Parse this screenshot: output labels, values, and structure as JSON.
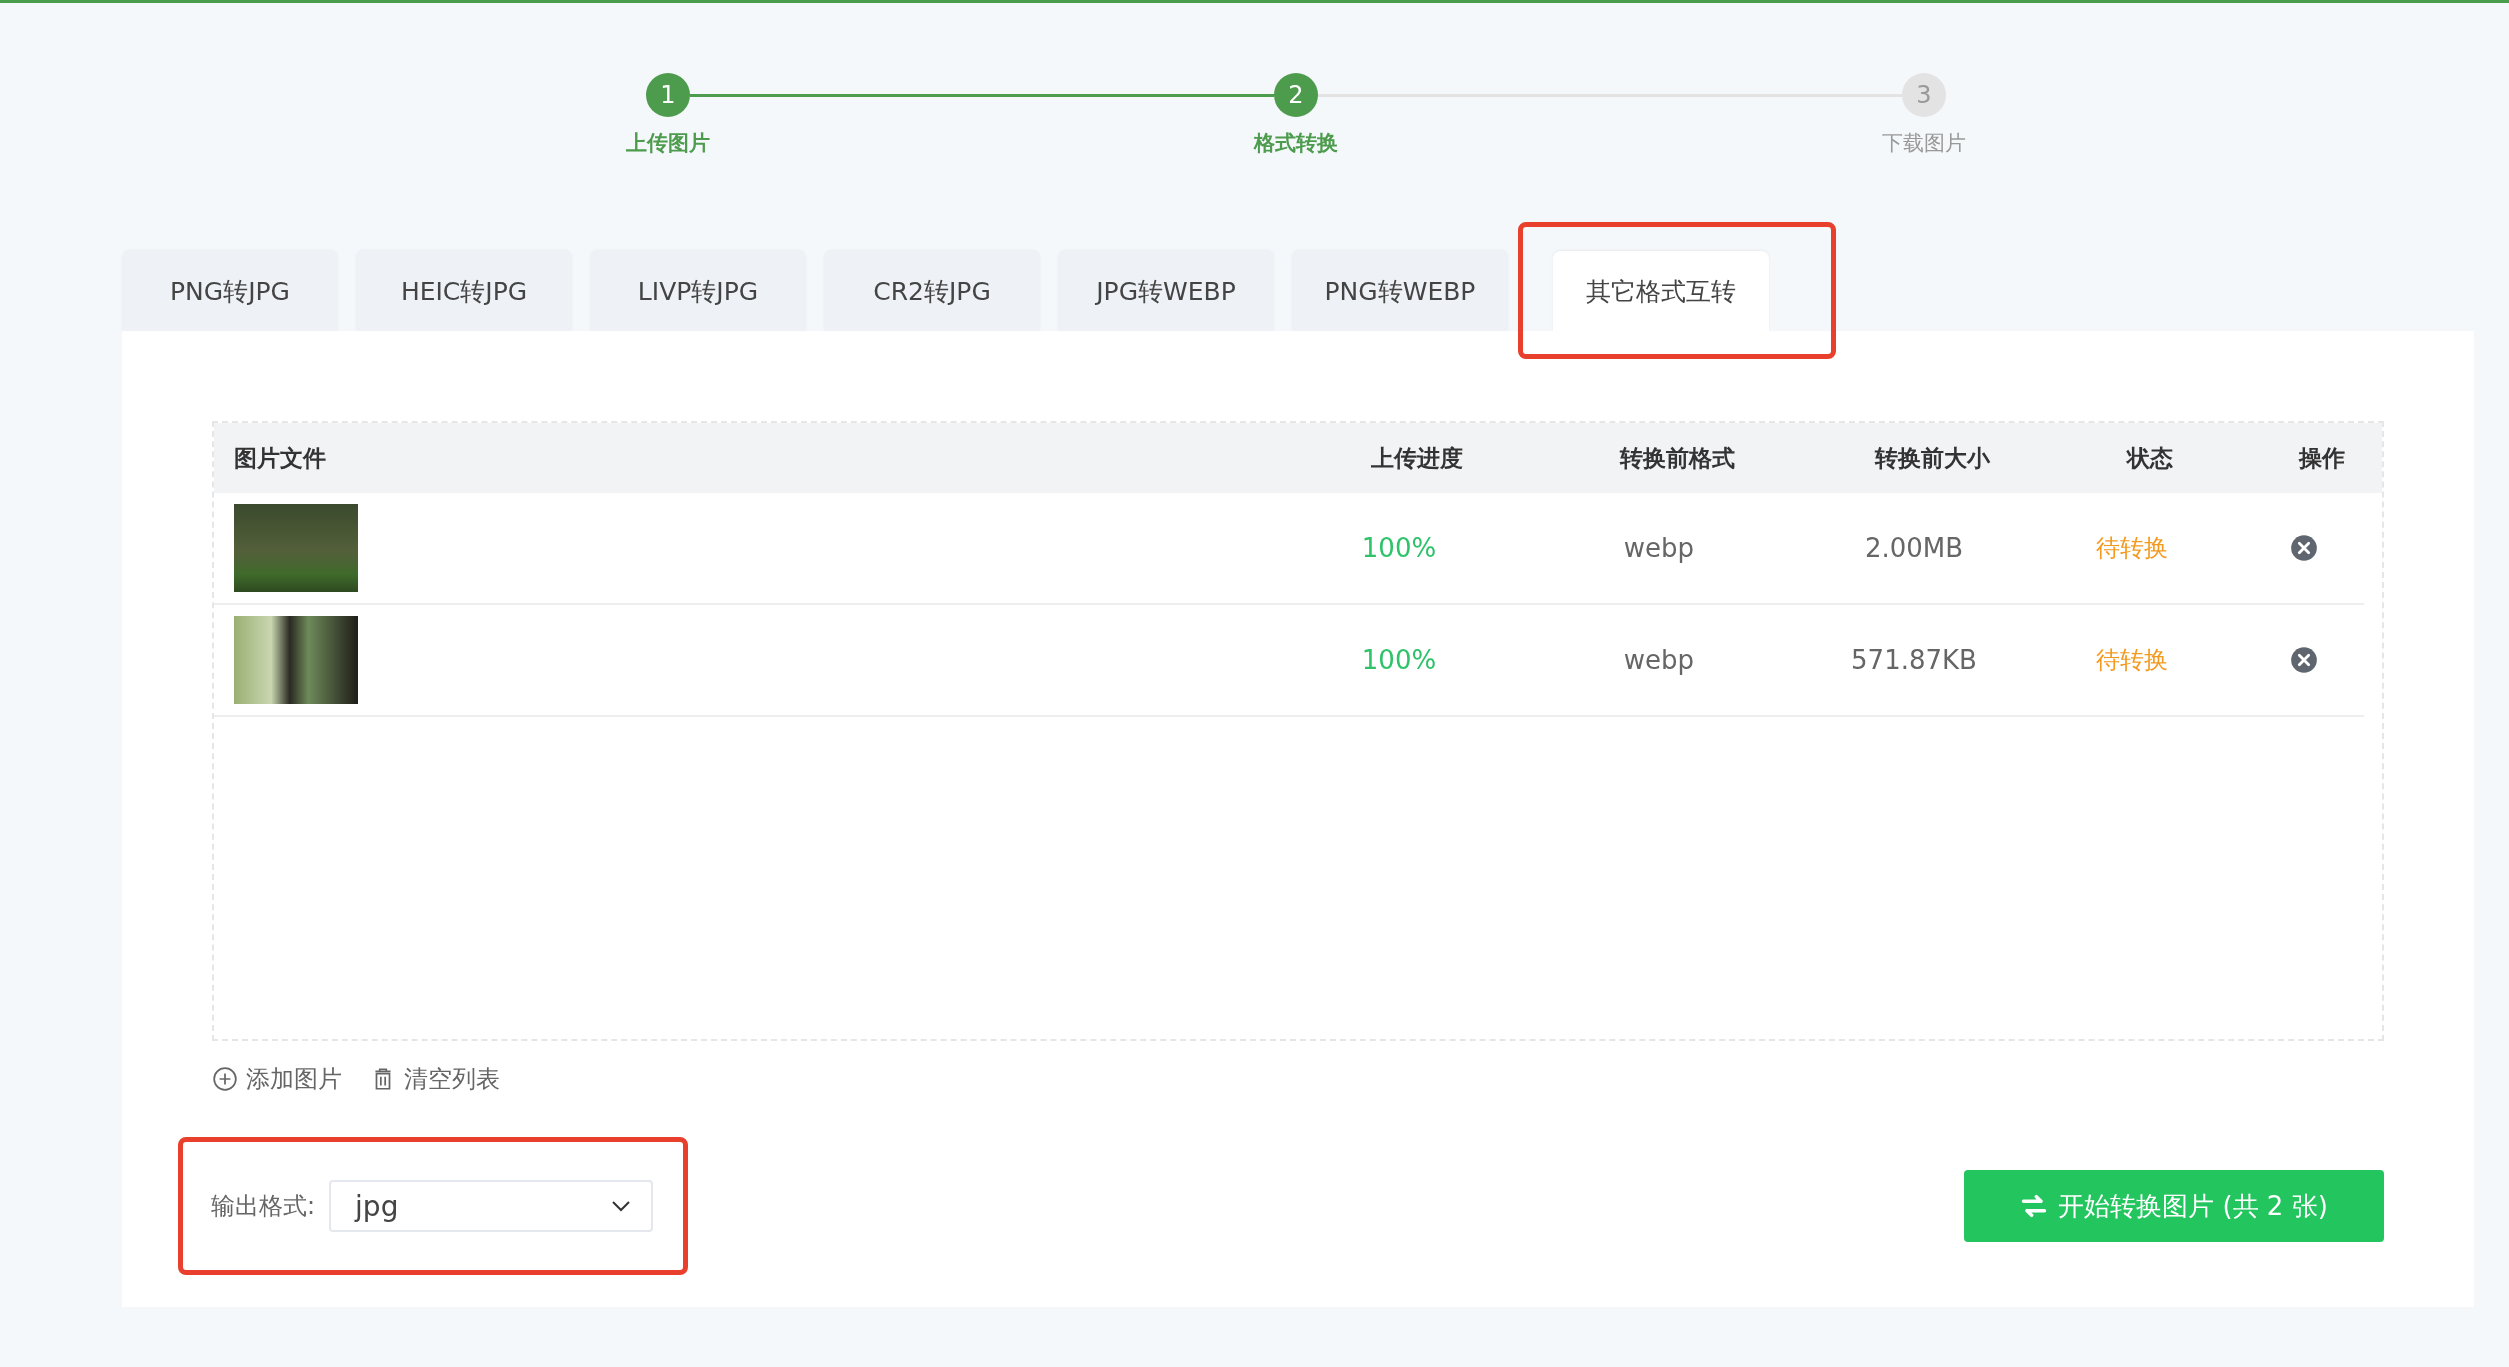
{
  "steps": [
    {
      "number": "1",
      "label": "上传图片",
      "active": true
    },
    {
      "number": "2",
      "label": "格式转换",
      "active": true
    },
    {
      "number": "3",
      "label": "下载图片",
      "active": false
    }
  ],
  "tabs": [
    {
      "label": "PNG转JPG",
      "selected": false,
      "highlighted": false
    },
    {
      "label": "HEIC转JPG",
      "selected": false,
      "highlighted": false
    },
    {
      "label": "LIVP转JPG",
      "selected": false,
      "highlighted": false
    },
    {
      "label": "CR2转JPG",
      "selected": false,
      "highlighted": false
    },
    {
      "label": "JPG转WEBP",
      "selected": false,
      "highlighted": false
    },
    {
      "label": "PNG转WEBP",
      "selected": false,
      "highlighted": false
    },
    {
      "label": "其它格式互转",
      "selected": true,
      "highlighted": true
    }
  ],
  "table": {
    "columns": [
      "图片文件",
      "上传进度",
      "转换前格式",
      "转换前大小",
      "状态",
      "操作"
    ],
    "rows": [
      {
        "progress": "100%",
        "format": "webp",
        "size": "2.00MB",
        "status": "待转换"
      },
      {
        "progress": "100%",
        "format": "webp",
        "size": "571.87KB",
        "status": "待转换"
      }
    ]
  },
  "actions": [
    "添加图片",
    "清空列表"
  ],
  "output_format": {
    "label": "输出格式:",
    "value": "jpg",
    "highlighted": true
  },
  "start_button": "开始转换图片 (共 2 张)"
}
